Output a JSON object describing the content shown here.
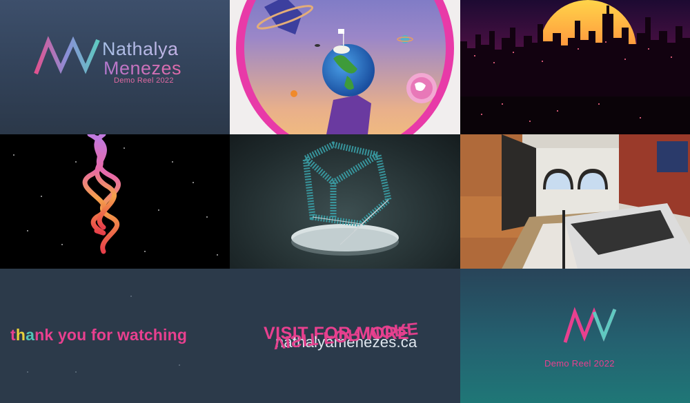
{
  "title_card": {
    "name_line1": "Nathalya",
    "name_line2": "Menezes",
    "subtitle": "Demo Reel 2022"
  },
  "outro_card": {
    "thanks_prefix_t": "t",
    "thanks_h": "h",
    "thanks_a": "a",
    "thanks_rest": "nk you for watching",
    "visit_text": "VISIT FOR MORE",
    "website": "nathalyamenezes.ca",
    "subtitle": "Demo Reel 2022"
  },
  "tiles": [
    {
      "name": "title-card"
    },
    {
      "name": "planet-scene"
    },
    {
      "name": "synthwave-city"
    },
    {
      "name": "spiral-ribbons"
    },
    {
      "name": "particle-cube"
    },
    {
      "name": "bedroom-interior"
    },
    {
      "name": "thank-you-card"
    },
    {
      "name": "visit-card"
    },
    {
      "name": "end-logo-card"
    }
  ],
  "colors": {
    "pink": "#e8408f",
    "teal": "#52c4b6",
    "yellow": "#e8d23c",
    "slate": "#2c3a4a"
  }
}
